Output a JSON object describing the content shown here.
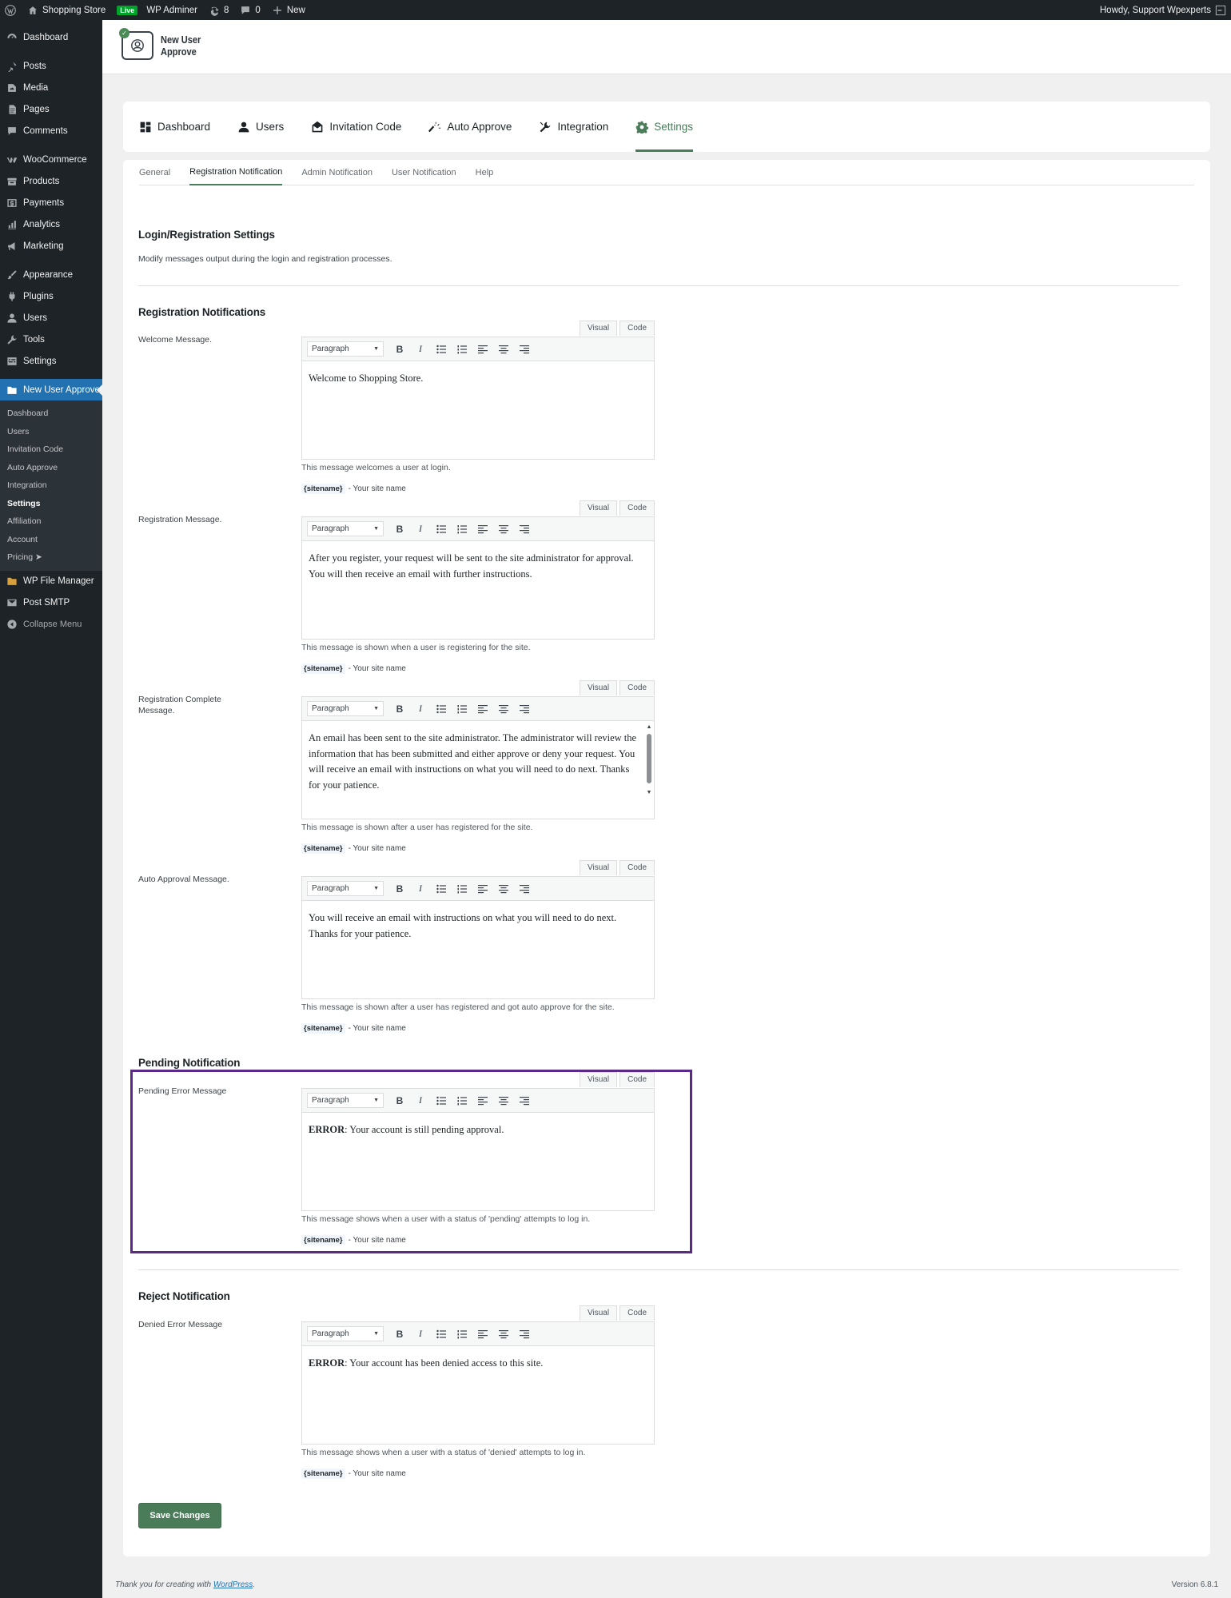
{
  "adminbar": {
    "site": "Shopping Store",
    "live": "Live",
    "adminer": "WP Adminer",
    "updates": "8",
    "comments": "0",
    "new": "New",
    "howdy": "Howdy, Support Wpexperts"
  },
  "sidebar": {
    "items": [
      {
        "label": "Dashboard",
        "icon": "dashboard-icon"
      },
      {
        "label": "Posts",
        "icon": "pin-icon"
      },
      {
        "label": "Media",
        "icon": "media-icon"
      },
      {
        "label": "Pages",
        "icon": "pages-icon"
      },
      {
        "label": "Comments",
        "icon": "comment-icon"
      },
      {
        "label": "WooCommerce",
        "icon": "woo-icon"
      },
      {
        "label": "Products",
        "icon": "archive-icon"
      },
      {
        "label": "Payments",
        "icon": "dollar-icon"
      },
      {
        "label": "Analytics",
        "icon": "chart-icon"
      },
      {
        "label": "Marketing",
        "icon": "megaphone-icon"
      },
      {
        "label": "Appearance",
        "icon": "brush-icon"
      },
      {
        "label": "Plugins",
        "icon": "plugin-icon"
      },
      {
        "label": "Users",
        "icon": "user-icon"
      },
      {
        "label": "Tools",
        "icon": "wrench-icon"
      },
      {
        "label": "Settings",
        "icon": "settings-icon"
      },
      {
        "label": "New User Approve",
        "icon": "folder-icon"
      }
    ],
    "submenu": [
      "Dashboard",
      "Users",
      "Invitation Code",
      "Auto Approve",
      "Integration",
      "Settings",
      "Affiliation",
      "Account",
      "Pricing ➤"
    ],
    "after": [
      {
        "label": "WP File Manager",
        "icon": "file-manager-icon"
      },
      {
        "label": "Post SMTP",
        "icon": "email-icon"
      },
      {
        "label": "Collapse Menu",
        "icon": "collapse-icon"
      }
    ]
  },
  "logo": {
    "line1": "New User",
    "line2": "Approve"
  },
  "topnav": [
    "Dashboard",
    "Users",
    "Invitation Code",
    "Auto Approve",
    "Integration",
    "Settings"
  ],
  "subtabs": [
    "General",
    "Registration Notification",
    "Admin Notification",
    "User Notification",
    "Help"
  ],
  "login_section": {
    "title": "Login/Registration Settings",
    "desc": "Modify messages output during the login and registration processes."
  },
  "editor": {
    "visual": "Visual",
    "code": "Code",
    "format": "Paragraph",
    "bold": "B",
    "italic": "I"
  },
  "tag": {
    "code": "{sitename}",
    "text": "- Your site name"
  },
  "reg_section": {
    "title": "Registration Notifications"
  },
  "fields": {
    "welcome": {
      "label": "Welcome Message.",
      "content": "Welcome to Shopping Store.",
      "help": "This message welcomes a user at login."
    },
    "registration": {
      "label": "Registration Message.",
      "content": "After you register, your request will be sent to the site administrator for approval. You will then receive an email with further instructions.",
      "help": "This message is shown when a user is registering for the site."
    },
    "complete": {
      "label": "Registration Complete Message.",
      "content": "An email has been sent to the site administrator. The administrator will review the information that has been submitted and either approve or deny your request. You will receive an email with instructions on what you will need to do next. Thanks for your patience.",
      "help": "This message is shown after a user has registered for the site."
    },
    "auto": {
      "label": "Auto Approval Message.",
      "content": "You will receive an email with instructions on what you will need to do next. Thanks for your patience.",
      "help": "This message is shown after a user has registered and got auto approve for the site."
    },
    "pending": {
      "label": "Pending Error Message",
      "strong": "ERROR",
      "content": ": Your account is still pending approval.",
      "help": "This message shows when a user with a status of 'pending' attempts to log in."
    },
    "denied": {
      "label": "Denied Error Message",
      "strong": "ERROR",
      "content": ": Your account has been denied access to this site.",
      "help": "This message shows when a user with a status of 'denied' attempts to log in."
    }
  },
  "pending_section": {
    "title": "Pending Notification"
  },
  "reject_section": {
    "title": "Reject Notification"
  },
  "save": "Save Changes",
  "footer": {
    "thanks": "Thank you for creating with",
    "link": "WordPress",
    "period": ".",
    "version": "Version 6.8.1"
  },
  "colors": {
    "accent": "#4a7c59",
    "sidebar": "#1d2327",
    "current": "#2271b1",
    "highlight": "#5b2a86"
  }
}
